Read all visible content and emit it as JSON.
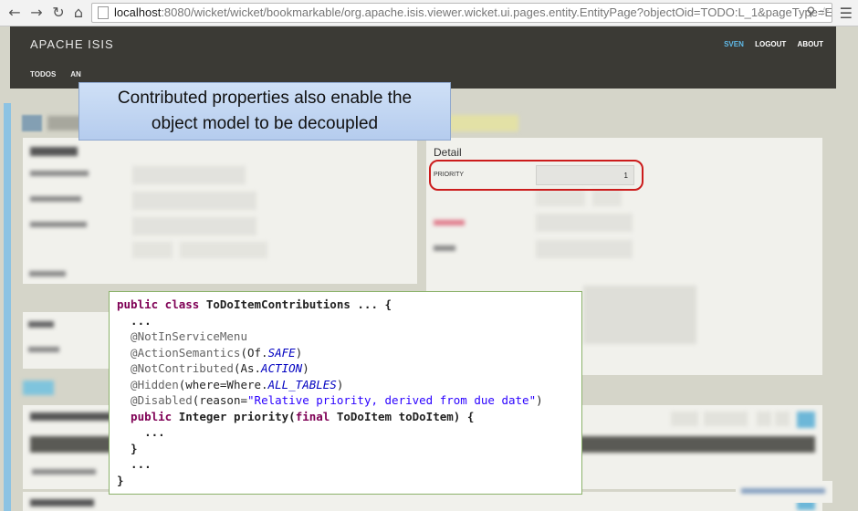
{
  "browser": {
    "url_host": "localhost",
    "url_rest": ":8080/wicket/wicket/bookmarkable/org.apache.isis.viewer.wicket.ui.pages.entity.EntityPage?objectOid=TODO:L_1&pageType=ENTI",
    "back_icon": "arrow-left-icon",
    "forward_icon": "arrow-right-icon",
    "reload_icon": "reload-icon",
    "home_icon": "home-icon",
    "zoom_icon": "magnifier-icon",
    "star_icon": "star-icon",
    "menu_icon": "hamburger-menu-icon"
  },
  "header": {
    "brand": "APACHE ISIS",
    "user": "SVEN",
    "logout": "LOGOUT",
    "about": "ABOUT",
    "nav": [
      "TODOS",
      "AN"
    ]
  },
  "callout": {
    "line1": "Contributed properties also enable the",
    "line2": "object model to be decoupled"
  },
  "detail": {
    "title": "Detail",
    "priority_label": "PRIORITY",
    "priority_value": "1"
  },
  "code": {
    "l1_kw": "public class",
    "l1_rest": " ToDoItemContributions ... {",
    "l2": "  ...",
    "l3_ann": "  @NotInServiceMenu",
    "l4_ann": "  @ActionSemantics",
    "l4_a": "(Of.",
    "l4_it": "SAFE",
    "l4_b": ")",
    "l5_ann": "  @NotContributed",
    "l5_a": "(As.",
    "l5_it": "ACTION",
    "l5_b": ")",
    "l6_ann": "  @Hidden",
    "l6_a": "(where=Where.",
    "l6_it": "ALL_TABLES",
    "l6_b": ")",
    "l7_ann": "  @Disabled",
    "l7_a": "(reason=",
    "l7_str": "\"Relative priority, derived from due date\"",
    "l7_b": ")",
    "l8_kw1": "  public",
    "l8_a": " Integer priority(",
    "l8_kw2": "final",
    "l8_b": " ToDoItem toDoItem) {",
    "l9": "    ...",
    "l10": "  }",
    "l11": "  ...",
    "l12": "}"
  },
  "colors": {
    "header_bg": "#3b3a35",
    "highlight": "#cc1c1c",
    "callout_bg": "#c4d7f2",
    "code_border": "#8bb26a"
  }
}
